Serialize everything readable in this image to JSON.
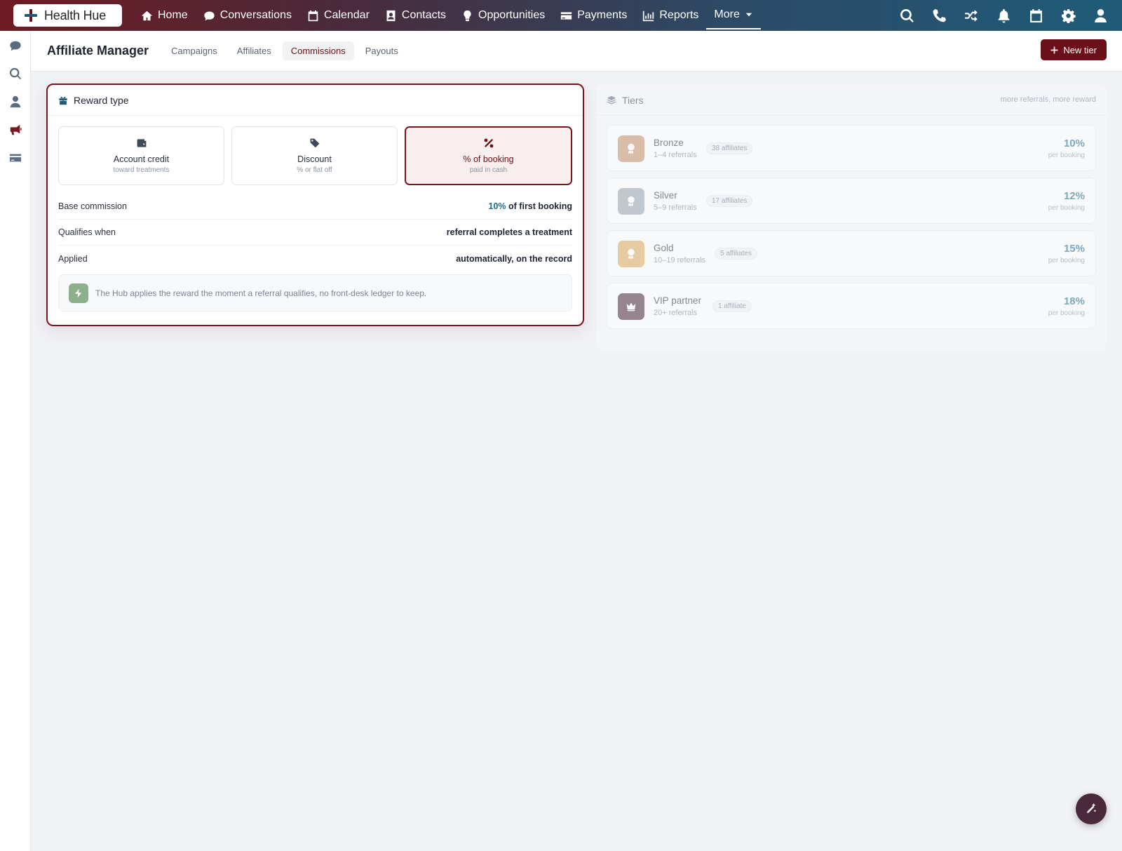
{
  "brand": {
    "name": "Health Hue"
  },
  "nav": {
    "items": [
      {
        "label": "Home",
        "icon": "home-icon"
      },
      {
        "label": "Conversations",
        "icon": "chat-icon"
      },
      {
        "label": "Calendar",
        "icon": "calendar-icon"
      },
      {
        "label": "Contacts",
        "icon": "contact-card-icon"
      },
      {
        "label": "Opportunities",
        "icon": "lightbulb-icon"
      },
      {
        "label": "Payments",
        "icon": "credit-card-icon"
      },
      {
        "label": "Reports",
        "icon": "bar-chart-icon"
      },
      {
        "label": "More",
        "icon": "caret-down-icon"
      }
    ],
    "right_icons": [
      "search-icon",
      "phone-icon",
      "shuffle-icon",
      "bell-icon",
      "calendar-icon",
      "gear-icon",
      "user-icon"
    ]
  },
  "rail": {
    "icons": [
      "chat-icon",
      "search-icon",
      "user-icon",
      "megaphone-icon",
      "credit-card-icon"
    ],
    "active": "megaphone-icon"
  },
  "header": {
    "title": "Affiliate Manager",
    "tabs": [
      {
        "label": "Campaigns"
      },
      {
        "label": "Affiliates"
      },
      {
        "label": "Commissions",
        "active": true
      },
      {
        "label": "Payouts"
      }
    ],
    "new_tier_label": "New tier"
  },
  "reward": {
    "title": "Reward type",
    "options": [
      {
        "label": "Account credit",
        "sub": "toward treatments",
        "icon": "wallet-icon"
      },
      {
        "label": "Discount",
        "sub": "% or flat off",
        "icon": "tag-icon"
      },
      {
        "label": "% of booking",
        "sub": "paid in cash",
        "icon": "percent-icon",
        "selected": true
      }
    ],
    "rows": [
      {
        "label": "Base commission",
        "value_accent": "10%",
        "value": " of first booking"
      },
      {
        "label": "Qualifies when",
        "value_accent": "",
        "value": "referral completes a treatment"
      },
      {
        "label": "Applied",
        "value_accent": "",
        "value": "automatically, on the record"
      }
    ],
    "note": "The Hub applies the reward the moment a referral qualifies, no front-desk ledger to keep."
  },
  "tiers": {
    "title": "Tiers",
    "caption": "more referrals, more reward",
    "items": [
      {
        "name": "Bronze",
        "range": "1–4 referrals",
        "count": "38 affiliates",
        "pct": "10%",
        "per": "per booking",
        "color": "#c8926c",
        "icon": "award-icon"
      },
      {
        "name": "Silver",
        "range": "5–9 referrals",
        "count": "17 affiliates",
        "pct": "12%",
        "per": "per booking",
        "color": "#9aa4b0",
        "icon": "award-icon"
      },
      {
        "name": "Gold",
        "range": "10–19 referrals",
        "count": "5 affiliates",
        "pct": "15%",
        "per": "per booking",
        "color": "#e0ad5a",
        "icon": "award-icon"
      },
      {
        "name": "VIP partner",
        "range": "20+ referrals",
        "count": "1 affiliate",
        "pct": "18%",
        "per": "per booking",
        "color": "#4a2a3a",
        "icon": "crown-icon"
      }
    ]
  },
  "colors": {
    "brand": "#6b1018",
    "accent": "#1f6b8a"
  }
}
